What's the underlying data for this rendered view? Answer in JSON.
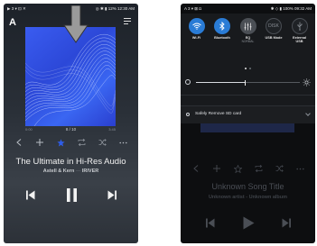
{
  "left_screen": {
    "status": {
      "left_icons": "▶ 3 ▾ ⊡ ✕",
      "right": "◎ ✱ ▮ 12% 12:30 AM"
    },
    "logo": "A",
    "track_counter": "8 / 10",
    "time_elapsed": "0:00",
    "time_total": "3:45",
    "song_title": "The Ultimate in Hi-Res Audio",
    "artist": "Astell & Kern",
    "separator": "—",
    "album": "IRIVER",
    "icons": {
      "back": "chevron-left-icon",
      "add": "plus-icon",
      "favorite": "star-icon",
      "repeat": "repeat-icon",
      "shuffle": "shuffle-icon",
      "more": "more-icon"
    },
    "accent_color": "#2f5de8"
  },
  "right_screen": {
    "status": {
      "left_icons": "A 3 ▾ ⊠ ◘",
      "right": "✱ ◇ ▮ 100% 09:32 AM"
    },
    "quick_settings": [
      {
        "label": "Wi-Fi",
        "sub": "",
        "state": "on"
      },
      {
        "label": "Bluetooth",
        "sub": "",
        "state": "on"
      },
      {
        "label": "EQ",
        "sub": "NORMAL",
        "state": "dim"
      },
      {
        "label": "USB Mode",
        "sub": "",
        "state": "off",
        "badge": "DISK"
      },
      {
        "label": "External USB",
        "sub": "",
        "state": "off"
      }
    ],
    "notification": "Safely Remove SD card",
    "song_title": "Unknown Song Title",
    "subtitle": "Unknown artist - Unknown album"
  }
}
